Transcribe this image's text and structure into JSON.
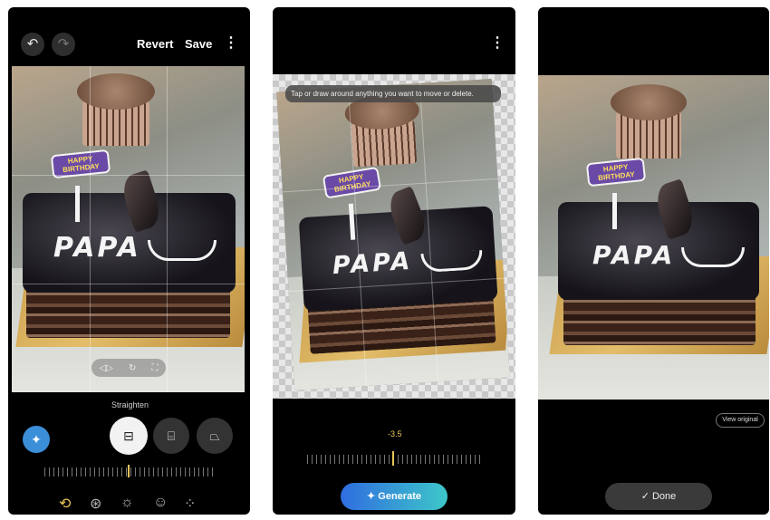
{
  "screen1": {
    "revert_label": "Revert",
    "save_label": "Save",
    "more_label": "⋮",
    "undo_icon": "undo-icon",
    "redo_icon": "redo-icon",
    "section_label": "Straighten",
    "topper_text": "HAPPY BIRTHDAY",
    "cake_text": "PAPA",
    "bottom_tools": [
      "crop-rotate-icon",
      "filter-icon",
      "brightness-icon",
      "sticker-icon",
      "more-tools-icon"
    ],
    "accent_color": "#e8c45a"
  },
  "screen2": {
    "more_label": "⋮",
    "hint_text": "Tap or draw around anything you want to move or delete.",
    "topper_text": "HAPPY BIRTHDAY",
    "cake_text": "PAPA",
    "value_text": "-3.5",
    "generate_label": "Generate"
  },
  "screen3": {
    "topper_text": "HAPPY BIRTHDAY",
    "cake_text": "PAPA",
    "view_original_label": "View original",
    "done_label": "Done"
  }
}
